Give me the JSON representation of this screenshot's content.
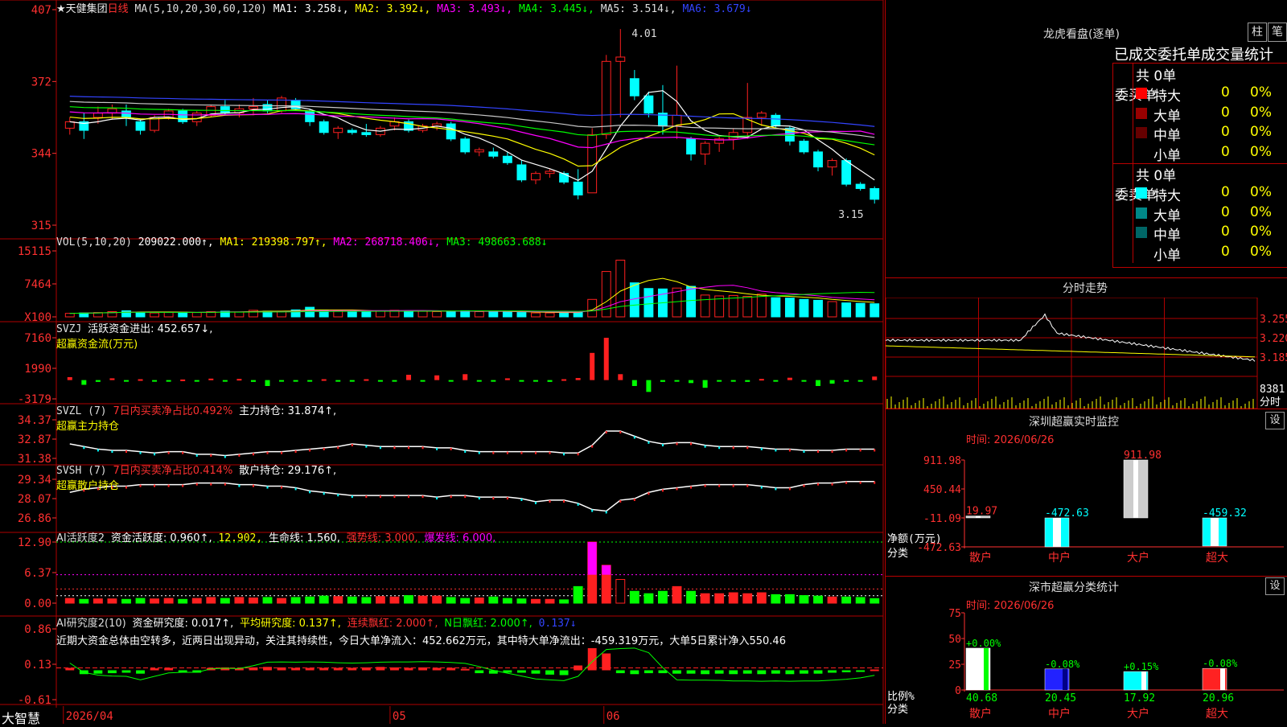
{
  "app": {
    "brand": "大智慧"
  },
  "stock": {
    "name": "★天健集团",
    "period": "日线"
  },
  "colors": {
    "ma1": "#ffffff",
    "ma2": "#ffff00",
    "ma3": "#ff00ff",
    "ma4": "#00ff00",
    "ma5": "#c8c8c8",
    "ma6": "#3344ff",
    "up": "#ff2020",
    "down": "#00ffff",
    "grid": "#b00000",
    "axis": "#ff3030"
  },
  "main_header": {
    "title": "MA(5,10,20,30,60,120)",
    "items": [
      {
        "label": "MA1: 3.258↓,",
        "color": "#ffffff"
      },
      {
        "label": "MA2: 3.392↓,",
        "color": "#ffff00"
      },
      {
        "label": "MA3: 3.493↓,",
        "color": "#ff00ff"
      },
      {
        "label": "MA4: 3.445↓,",
        "color": "#00ff00"
      },
      {
        "label": "MA5: 3.514↓,",
        "color": "#dddddd"
      },
      {
        "label": "MA6: 3.679↓",
        "color": "#3344ff"
      }
    ],
    "high_label": "4.01",
    "low_label": "3.15"
  },
  "vol_header": {
    "title": "VOL(5,10,20)",
    "value": "209022.000↑,",
    "ma1": "MA1: 219398.797↑,",
    "ma2": "MA2: 268718.406↓,",
    "ma3": "MA3: 498663.688↓",
    "multiplier": "X100"
  },
  "svzj_header": {
    "title": "SVZJ",
    "label": "活跃资金进出: 452.657↓,",
    "subtitle": "超赢资金流(万元)"
  },
  "svzl_header": {
    "title": "SVZL (7)",
    "label1": "7日内买卖净占比0.492%",
    "label2": "主力持仓: 31.874↑,",
    "subtitle": "超赢主力持仓"
  },
  "svsh_header": {
    "title": "SVSH (7)",
    "label1": "7日内买卖净占比0.414%",
    "label2": "散户持仓: 29.176↑,",
    "subtitle": "超赢散户持仓"
  },
  "ai1_header": {
    "title": "AI活跃度2",
    "l1": "资金活跃度: 0.960↑,",
    "l2": "12.902,",
    "l3": "生命线: 1.560,",
    "l4": "强势线: 3.000,",
    "l5": "爆发线: 6.000,"
  },
  "ai2_header": {
    "title": "AI研究度2(10)",
    "l1": "资金研究度: 0.017↑,",
    "l2": "平均研究度: 0.137↑,",
    "l3": "连续飘红: 2.000↑,",
    "l4": "N日飘红: 2.000↑,",
    "l5": "0.137↓",
    "comment": "近期大资金总体由空转多，近两日出现异动，关注其持续性，今日大单净流入：452.662万元，其中特大单净流出：-459.319万元，大单5日累计净入550.46"
  },
  "y_axes": {
    "price": [
      "407",
      "372",
      "344",
      "315"
    ],
    "vol": [
      "15115",
      "7464",
      "X100"
    ],
    "svzj": [
      "7160",
      "1990",
      "-3179"
    ],
    "svzl": [
      "34.37",
      "32.87",
      "31.38"
    ],
    "svsh": [
      "29.34",
      "28.07",
      "26.86"
    ],
    "ai1": [
      "12.90",
      "6.37",
      "0.00"
    ],
    "ai2": [
      "0.86",
      "0.13",
      "-0.61"
    ]
  },
  "x_axis": [
    "2026/04",
    "05",
    "06"
  ],
  "lhb": {
    "title": "龙虎看盘(逐单)",
    "tab1": "柱",
    "tab2": "笔",
    "subtitle": "已成交委托单成交量统计",
    "buy": {
      "side": "委买单",
      "total": "共 0单",
      "rows": [
        {
          "label": "特大",
          "count": "0",
          "pct": "0%",
          "color": "#ff0000"
        },
        {
          "label": "大单",
          "count": "0",
          "pct": "0%",
          "color": "#990000"
        },
        {
          "label": "中单",
          "count": "0",
          "pct": "0%",
          "color": "#660000"
        },
        {
          "label": "小单",
          "count": "0",
          "pct": "0%",
          "color": "#000000"
        }
      ]
    },
    "sell": {
      "side": "委卖单",
      "total": "共 0单",
      "rows": [
        {
          "label": "特大",
          "count": "0",
          "pct": "0%",
          "color": "#00ffff"
        },
        {
          "label": "大单",
          "count": "0",
          "pct": "0%",
          "color": "#008888"
        },
        {
          "label": "中单",
          "count": "0",
          "pct": "0%",
          "color": "#006666"
        },
        {
          "label": "小单",
          "count": "0",
          "pct": "0%",
          "color": "#000000"
        }
      ]
    }
  },
  "intraday": {
    "title": "分时走势",
    "prices": [
      "3.255",
      "3.220",
      "3.185"
    ],
    "vol": "8381",
    "unit": "分时"
  },
  "sz_monitor": {
    "title": "深圳超赢实时监控",
    "button": "设",
    "time": "时间: 2026/06/26",
    "y": [
      "911.98",
      "450.44",
      "-11.09",
      "-472.63"
    ],
    "ylabel": "净额(万元)",
    "xlabel": "分类",
    "bars": [
      {
        "cat": "散户",
        "value": 19.97,
        "label": "19.97"
      },
      {
        "cat": "中户",
        "value": -472.63,
        "label": "-472.63"
      },
      {
        "cat": "大户",
        "value": 911.98,
        "label": "911.98"
      },
      {
        "cat": "超大",
        "value": -459.32,
        "label": "-459.32"
      }
    ]
  },
  "sz_class": {
    "title": "深市超赢分类统计",
    "button": "设",
    "time": "时间: 2026/06/26",
    "y": [
      "75",
      "50",
      "25",
      "0"
    ],
    "ylabel": "比例%",
    "xlabel": "分类",
    "bars": [
      {
        "cat": "散户",
        "value": 40.68,
        "label": "40.68",
        "chg": "+0.00%",
        "color": "#ffffff",
        "accent": "#00ff00"
      },
      {
        "cat": "中户",
        "value": 20.45,
        "label": "20.45",
        "chg": "-0.08%",
        "color": "#2222ff",
        "accent": "#000088"
      },
      {
        "cat": "大户",
        "value": 17.92,
        "label": "17.92",
        "chg": "+0.15%",
        "color": "#00ffff",
        "accent": "#ffffff"
      },
      {
        "cat": "超大",
        "value": 20.96,
        "label": "20.96",
        "chg": "-0.08%",
        "color": "#ff2222",
        "accent": "#ffffff"
      }
    ]
  },
  "chart_data": [
    {
      "type": "candlestick",
      "name": "天健集团 日线",
      "ylim": [
        3.1,
        4.1
      ],
      "ohlc": [
        [
          3.55,
          3.6,
          3.52,
          3.58
        ],
        [
          3.58,
          3.62,
          3.5,
          3.54
        ],
        [
          3.6,
          3.65,
          3.57,
          3.62
        ],
        [
          3.62,
          3.66,
          3.59,
          3.64
        ],
        [
          3.63,
          3.66,
          3.56,
          3.6
        ],
        [
          3.58,
          3.59,
          3.52,
          3.54
        ],
        [
          3.54,
          3.61,
          3.53,
          3.6
        ],
        [
          3.6,
          3.64,
          3.59,
          3.63
        ],
        [
          3.63,
          3.64,
          3.57,
          3.58
        ],
        [
          3.58,
          3.63,
          3.56,
          3.62
        ],
        [
          3.61,
          3.66,
          3.6,
          3.65
        ],
        [
          3.65,
          3.68,
          3.61,
          3.62
        ],
        [
          3.62,
          3.66,
          3.6,
          3.64
        ],
        [
          3.64,
          3.69,
          3.61,
          3.65
        ],
        [
          3.66,
          3.68,
          3.62,
          3.63
        ],
        [
          3.63,
          3.7,
          3.62,
          3.69
        ],
        [
          3.68,
          3.69,
          3.63,
          3.64
        ],
        [
          3.63,
          3.64,
          3.56,
          3.58
        ],
        [
          3.58,
          3.59,
          3.52,
          3.53
        ],
        [
          3.53,
          3.56,
          3.5,
          3.55
        ],
        [
          3.54,
          3.55,
          3.52,
          3.53
        ],
        [
          3.53,
          3.57,
          3.51,
          3.52
        ],
        [
          3.52,
          3.56,
          3.51,
          3.55
        ],
        [
          3.56,
          3.6,
          3.54,
          3.58
        ],
        [
          3.58,
          3.59,
          3.53,
          3.54
        ],
        [
          3.54,
          3.57,
          3.53,
          3.56
        ],
        [
          3.56,
          3.58,
          3.54,
          3.57
        ],
        [
          3.57,
          3.58,
          3.49,
          3.5
        ],
        [
          3.5,
          3.51,
          3.43,
          3.44
        ],
        [
          3.44,
          3.46,
          3.42,
          3.45
        ],
        [
          3.44,
          3.46,
          3.41,
          3.42
        ],
        [
          3.42,
          3.44,
          3.38,
          3.39
        ],
        [
          3.38,
          3.4,
          3.3,
          3.31
        ],
        [
          3.31,
          3.35,
          3.29,
          3.34
        ],
        [
          3.34,
          3.36,
          3.32,
          3.35
        ],
        [
          3.34,
          3.35,
          3.29,
          3.3
        ],
        [
          3.3,
          3.36,
          3.22,
          3.24
        ],
        [
          3.25,
          3.55,
          3.25,
          3.52
        ],
        [
          3.52,
          3.89,
          3.5,
          3.86
        ],
        [
          3.86,
          4.01,
          3.6,
          3.88
        ],
        [
          3.78,
          3.82,
          3.68,
          3.7
        ],
        [
          3.7,
          3.72,
          3.6,
          3.62
        ],
        [
          3.62,
          3.75,
          3.52,
          3.56
        ],
        [
          3.56,
          3.84,
          3.5,
          3.61
        ],
        [
          3.5,
          3.51,
          3.4,
          3.43
        ],
        [
          3.43,
          3.49,
          3.38,
          3.48
        ],
        [
          3.48,
          3.51,
          3.44,
          3.5
        ],
        [
          3.5,
          3.55,
          3.45,
          3.53
        ],
        [
          3.53,
          3.76,
          3.5,
          3.6
        ],
        [
          3.6,
          3.63,
          3.56,
          3.62
        ],
        [
          3.61,
          3.62,
          3.55,
          3.56
        ],
        [
          3.55,
          3.56,
          3.47,
          3.49
        ],
        [
          3.49,
          3.5,
          3.43,
          3.44
        ],
        [
          3.44,
          3.45,
          3.35,
          3.37
        ],
        [
          3.37,
          3.41,
          3.33,
          3.4
        ],
        [
          3.4,
          3.41,
          3.28,
          3.29
        ],
        [
          3.29,
          3.3,
          3.26,
          3.27
        ],
        [
          3.27,
          3.28,
          3.2,
          3.22
        ]
      ]
    },
    {
      "type": "bar",
      "name": "VOL",
      "ylim": [
        0,
        15115
      ],
      "values": [
        800,
        900,
        1000,
        1200,
        1400,
        1100,
        900,
        1000,
        1100,
        1000,
        1200,
        1300,
        1100,
        1500,
        1300,
        1300,
        1600,
        2200,
        1500,
        1400,
        1200,
        1100,
        1300,
        1500,
        1400,
        1300,
        1200,
        1200,
        1400,
        1200,
        1300,
        1100,
        1000,
        900,
        900,
        1000,
        1100,
        4000,
        10400,
        13000,
        7800,
        6500,
        6400,
        6600,
        7000,
        5000,
        4800,
        4900,
        4700,
        5200,
        4400,
        4300,
        4000,
        3800,
        3500,
        3200,
        3100,
        3000
      ]
    },
    {
      "type": "bar",
      "name": "超赢资金流",
      "ylim": [
        -3179,
        7160
      ],
      "values": [
        500,
        -800,
        -300,
        300,
        -200,
        150,
        -200,
        -150,
        100,
        -100,
        250,
        -150,
        200,
        -300,
        -1000,
        -250,
        -200,
        -100,
        150,
        -200,
        -120,
        150,
        -100,
        -150,
        900,
        -200,
        800,
        -150,
        1000,
        -150,
        -200,
        300,
        -150,
        -100,
        -300,
        150,
        350,
        4600,
        7160,
        1000,
        -1000,
        -2000,
        -300,
        -150,
        -500,
        -1300,
        -200,
        -150,
        -300,
        200,
        -100,
        400,
        -200,
        -1000,
        -600,
        -250,
        -150,
        600
      ]
    },
    {
      "type": "line",
      "name": "超赢主力持仓",
      "ylim": [
        31.38,
        34.37
      ],
      "values": [
        32.5,
        32.3,
        32.1,
        32.0,
        32.0,
        31.9,
        31.8,
        31.9,
        31.9,
        31.7,
        31.7,
        31.6,
        31.7,
        31.8,
        31.9,
        31.9,
        32.0,
        32.1,
        32.2,
        32.3,
        32.5,
        32.4,
        32.3,
        32.3,
        32.3,
        32.3,
        32.2,
        32.2,
        32.0,
        31.9,
        31.9,
        31.9,
        31.9,
        31.9,
        31.9,
        31.8,
        31.8,
        32.4,
        33.5,
        33.5,
        33.1,
        32.7,
        32.5,
        32.6,
        32.6,
        32.4,
        32.3,
        32.3,
        32.3,
        32.2,
        32.1,
        32.1,
        32.0,
        32.0,
        32.0,
        32.1,
        32.1,
        32.1
      ]
    },
    {
      "type": "line",
      "name": "超赢散户持仓",
      "ylim": [
        26.86,
        29.34
      ],
      "values": [
        28.5,
        28.7,
        28.8,
        28.9,
        28.9,
        29.0,
        29.0,
        29.0,
        29.0,
        29.1,
        29.1,
        29.1,
        29.0,
        29.0,
        28.9,
        28.9,
        28.8,
        28.6,
        28.5,
        28.4,
        28.3,
        28.3,
        28.3,
        28.3,
        28.3,
        28.3,
        28.2,
        28.3,
        28.3,
        28.2,
        28.2,
        28.2,
        28.1,
        27.9,
        28.0,
        28.0,
        27.8,
        27.4,
        27.3,
        28.0,
        28.1,
        28.5,
        28.7,
        28.8,
        28.9,
        29.0,
        29.0,
        29.0,
        29.0,
        28.9,
        28.8,
        28.8,
        29.0,
        29.1,
        29.1,
        29.2,
        29.2,
        29.2
      ]
    },
    {
      "type": "bar",
      "name": "AI活跃度2",
      "ylim": [
        0,
        12.9
      ],
      "values": [
        1,
        0.8,
        0.9,
        0.9,
        0.8,
        1,
        0.9,
        1,
        0.8,
        1,
        1.2,
        1,
        1.2,
        1.1,
        1.2,
        1,
        1.2,
        1.3,
        1.5,
        1.4,
        1.3,
        1.2,
        1.4,
        1.3,
        1.6,
        1.5,
        1.5,
        1.2,
        1,
        1.1,
        1.3,
        1,
        0.9,
        0.8,
        0.8,
        0.7,
        3.5,
        12.9,
        8.0,
        5.0,
        2.5,
        2.0,
        2.5,
        3.5,
        2.5,
        2.0,
        2.0,
        2.2,
        2.0,
        2.2,
        1.8,
        1.8,
        1.6,
        1.5,
        1.3,
        1.3,
        1.2,
        0.96
      ]
    },
    {
      "type": "bar",
      "name": "AI研究度2(10)",
      "ylim": [
        -0.61,
        0.86
      ],
      "values": [
        0.05,
        -0.08,
        -0.07,
        -0.06,
        -0.05,
        -0.07,
        0.04,
        0.05,
        -0.04,
        -0.05,
        0.05,
        0.06,
        0.04,
        0.06,
        0.07,
        0.06,
        0.05,
        0.05,
        0.05,
        0.05,
        0.05,
        0.06,
        0.07,
        0.06,
        0.05,
        0.06,
        0.05,
        0.05,
        0.03,
        -0.06,
        -0.07,
        -0.05,
        -0.05,
        -0.07,
        -0.09,
        -0.1,
        0.1,
        0.46,
        0.35,
        -0.06,
        -0.08,
        -0.06,
        -0.06,
        -0.07,
        -0.07,
        -0.08,
        -0.07,
        -0.08,
        -0.07,
        -0.08,
        -0.07,
        -0.08,
        -0.07,
        -0.07,
        -0.05,
        -0.04,
        -0.03,
        0.017
      ]
    }
  ]
}
